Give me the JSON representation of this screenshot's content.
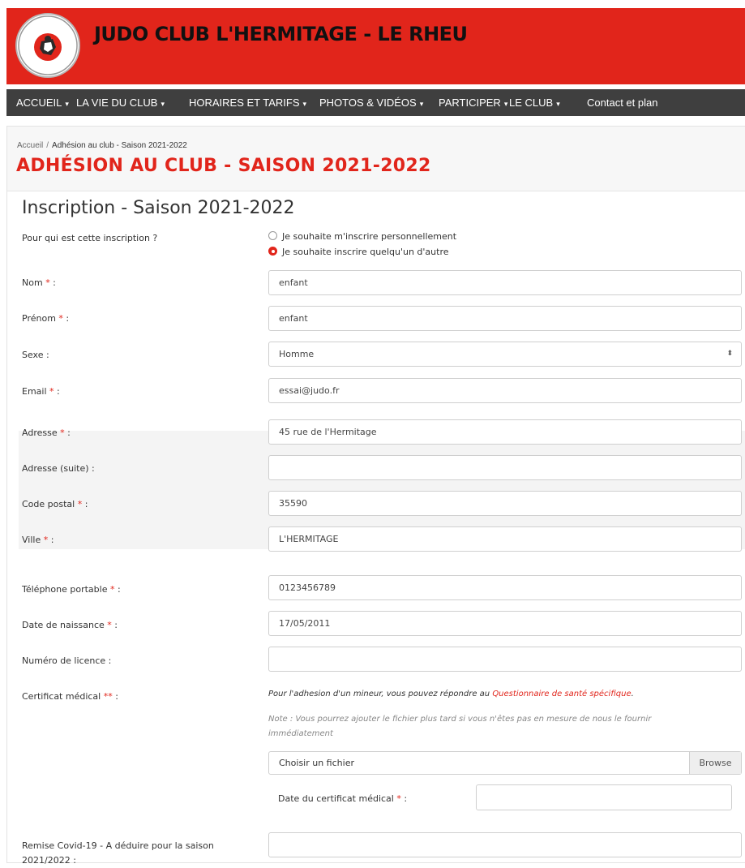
{
  "header": {
    "title": "JUDO CLUB L'HERMITAGE - LE RHEU",
    "logo_text_top": "JUDO CLUB",
    "logo_text_bottom": "L'HERMITAGE - LE RHEU",
    "brand_color": "#e1251b"
  },
  "nav": {
    "items": [
      {
        "label": "ACCUEIL",
        "caret": "▾"
      },
      {
        "label": "LA VIE DU CLUB",
        "caret": "▾"
      },
      {
        "label": "HORAIRES ET TARIFS",
        "caret": "▾"
      },
      {
        "label": "PHOTOS & VIDÉOS",
        "caret": "▾"
      },
      {
        "label": "PARTICIPER",
        "caret": "▾"
      },
      {
        "label": "LE CLUB",
        "caret": "▾"
      },
      {
        "label": "Contact et plan",
        "caret": ""
      }
    ]
  },
  "breadcrumb": {
    "home": "Accueil",
    "separator": "/",
    "current": "Adhésion au club - Saison 2021-2022"
  },
  "page_title": "ADHÉSION AU CLUB - SAISON 2021-2022",
  "form": {
    "title": "Inscription - Saison 2021-2022",
    "who": {
      "label": "Pour qui est cette inscription ?",
      "options": [
        "Je souhaite m'inscrire personnellement",
        "Je souhaite inscrire quelqu'un d'autre"
      ],
      "selected_index": 1
    },
    "required_mark": "*",
    "required_mark_double": "**",
    "fields": {
      "nom": {
        "label": "Nom",
        "value": "enfant"
      },
      "prenom": {
        "label": "Prénom",
        "value": "enfant"
      },
      "sexe": {
        "label": "Sexe :",
        "value": "Homme",
        "arrow": "⬍"
      },
      "email": {
        "label": "Email",
        "value": "essai@judo.fr"
      },
      "adresse": {
        "label": "Adresse",
        "value": "45 rue de l'Hermitage"
      },
      "adresse_suite": {
        "label": "Adresse (suite) :",
        "value": ""
      },
      "code_postal": {
        "label": "Code postal",
        "value": "35590"
      },
      "ville": {
        "label": "Ville",
        "value": "L'HERMITAGE"
      },
      "telephone": {
        "label": "Téléphone portable",
        "value": "0123456789"
      },
      "naissance": {
        "label": "Date de naissance",
        "value": "17/05/2011"
      },
      "licence": {
        "label": "Numéro de licence :",
        "value": ""
      },
      "certificat": {
        "label": "Certificat médical",
        "note_prefix": "Pour l'adhesion d'un mineur, vous pouvez répondre au ",
        "note_link": "Questionnaire de santé spécifique",
        "note_suffix": ".",
        "note2": "Note : Vous pourrez ajouter le fichier plus tard si vous n'êtes pas en mesure de nous le fournir immédiatement",
        "file_placeholder": "Choisir un fichier",
        "browse_label": "Browse",
        "date_label": "Date du certificat médical",
        "date_value": ""
      },
      "remise": {
        "label": "Remise Covid-19 - A déduire pour la saison 2021/2022 :",
        "value": ""
      }
    },
    "label_suffix": " :"
  }
}
